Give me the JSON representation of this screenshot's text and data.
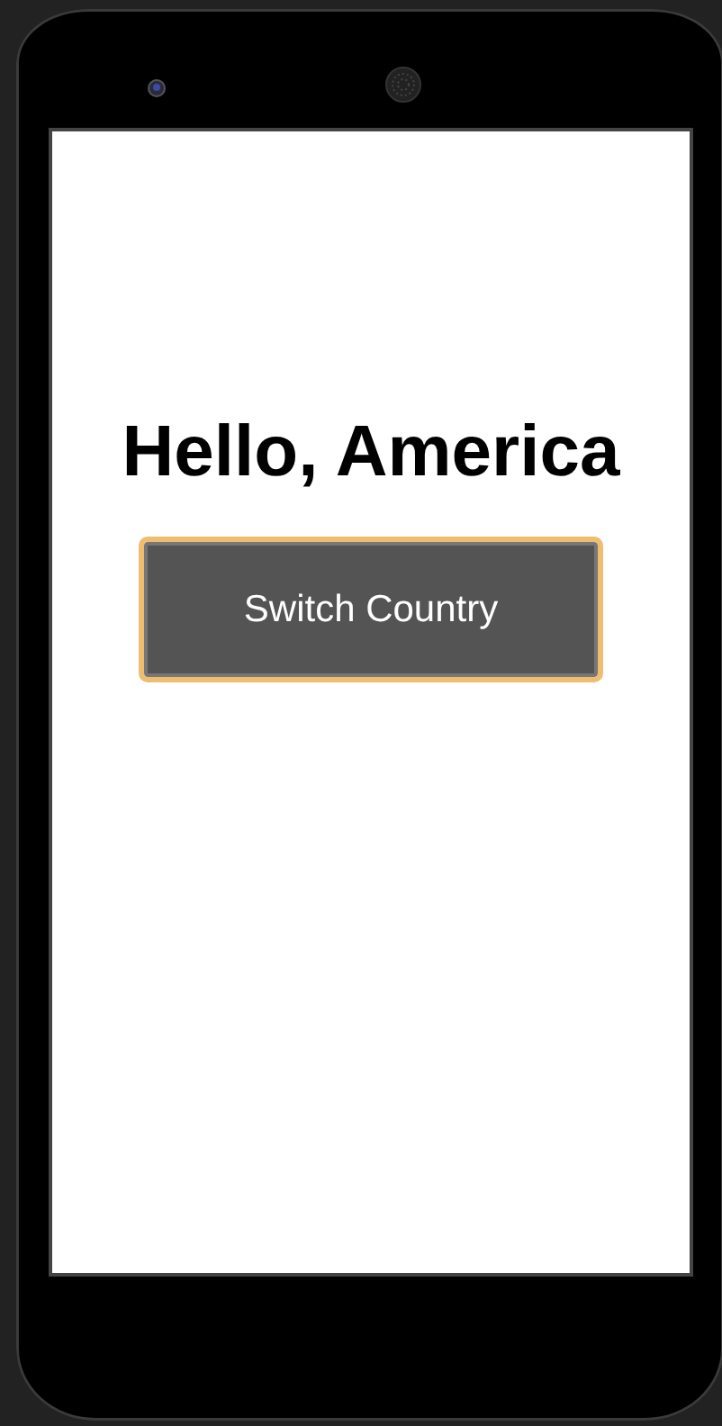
{
  "screen": {
    "heading": "Hello, America",
    "button": {
      "label": "Switch Country",
      "focused": true
    }
  }
}
